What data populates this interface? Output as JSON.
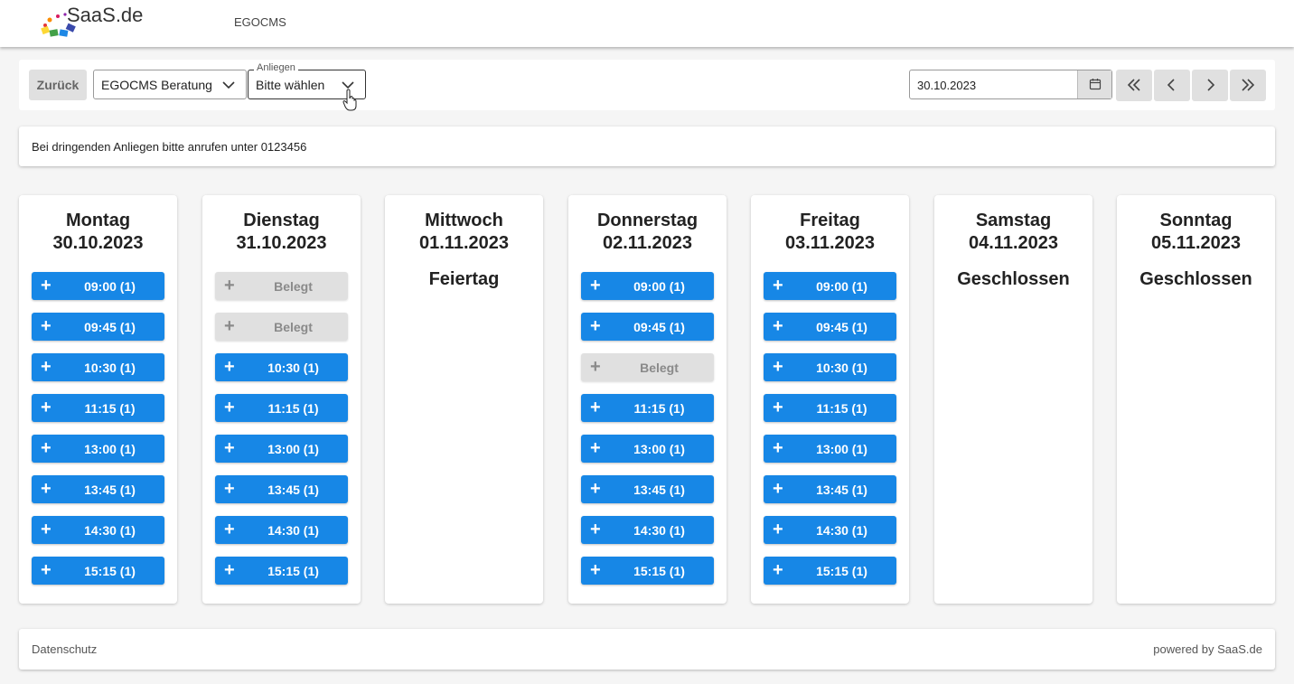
{
  "header": {
    "logo_text": "SaaS.de",
    "app_name": "EGOCMS"
  },
  "toolbar": {
    "back_label": "Zurück",
    "service_select": "EGOCMS Beratung",
    "concern_legend": "Anliegen",
    "concern_select": "Bitte wählen",
    "date_value": "30.10.2023"
  },
  "notice": "Bei dringenden Anliegen bitte anrufen unter 0123456",
  "days": [
    {
      "name": "Montag",
      "date": "30.10.2023",
      "status": "",
      "slots": [
        {
          "label": "09:00 (1)",
          "taken": false
        },
        {
          "label": "09:45 (1)",
          "taken": false
        },
        {
          "label": "10:30 (1)",
          "taken": false
        },
        {
          "label": "11:15 (1)",
          "taken": false
        },
        {
          "label": "13:00 (1)",
          "taken": false
        },
        {
          "label": "13:45 (1)",
          "taken": false
        },
        {
          "label": "14:30 (1)",
          "taken": false
        },
        {
          "label": "15:15 (1)",
          "taken": false
        }
      ]
    },
    {
      "name": "Dienstag",
      "date": "31.10.2023",
      "status": "",
      "slots": [
        {
          "label": "Belegt",
          "taken": true
        },
        {
          "label": "Belegt",
          "taken": true
        },
        {
          "label": "10:30 (1)",
          "taken": false
        },
        {
          "label": "11:15 (1)",
          "taken": false
        },
        {
          "label": "13:00 (1)",
          "taken": false
        },
        {
          "label": "13:45 (1)",
          "taken": false
        },
        {
          "label": "14:30 (1)",
          "taken": false
        },
        {
          "label": "15:15 (1)",
          "taken": false
        }
      ]
    },
    {
      "name": "Mittwoch",
      "date": "01.11.2023",
      "status": "Feiertag",
      "slots": []
    },
    {
      "name": "Donnerstag",
      "date": "02.11.2023",
      "status": "",
      "slots": [
        {
          "label": "09:00 (1)",
          "taken": false
        },
        {
          "label": "09:45 (1)",
          "taken": false
        },
        {
          "label": "Belegt",
          "taken": true
        },
        {
          "label": "11:15 (1)",
          "taken": false
        },
        {
          "label": "13:00 (1)",
          "taken": false
        },
        {
          "label": "13:45 (1)",
          "taken": false
        },
        {
          "label": "14:30 (1)",
          "taken": false
        },
        {
          "label": "15:15 (1)",
          "taken": false
        }
      ]
    },
    {
      "name": "Freitag",
      "date": "03.11.2023",
      "status": "",
      "slots": [
        {
          "label": "09:00 (1)",
          "taken": false
        },
        {
          "label": "09:45 (1)",
          "taken": false
        },
        {
          "label": "10:30 (1)",
          "taken": false
        },
        {
          "label": "11:15 (1)",
          "taken": false
        },
        {
          "label": "13:00 (1)",
          "taken": false
        },
        {
          "label": "13:45 (1)",
          "taken": false
        },
        {
          "label": "14:30 (1)",
          "taken": false
        },
        {
          "label": "15:15 (1)",
          "taken": false
        }
      ]
    },
    {
      "name": "Samstag",
      "date": "04.11.2023",
      "status": "Geschlossen",
      "slots": []
    },
    {
      "name": "Sonntag",
      "date": "05.11.2023",
      "status": "Geschlossen",
      "slots": []
    }
  ],
  "slot_icon": "+",
  "footer": {
    "privacy_link": "Datenschutz",
    "powered_by": "powered by SaaS.de"
  },
  "colors": {
    "slot_free": "#1787e6",
    "slot_taken": "#e0e0e0"
  }
}
